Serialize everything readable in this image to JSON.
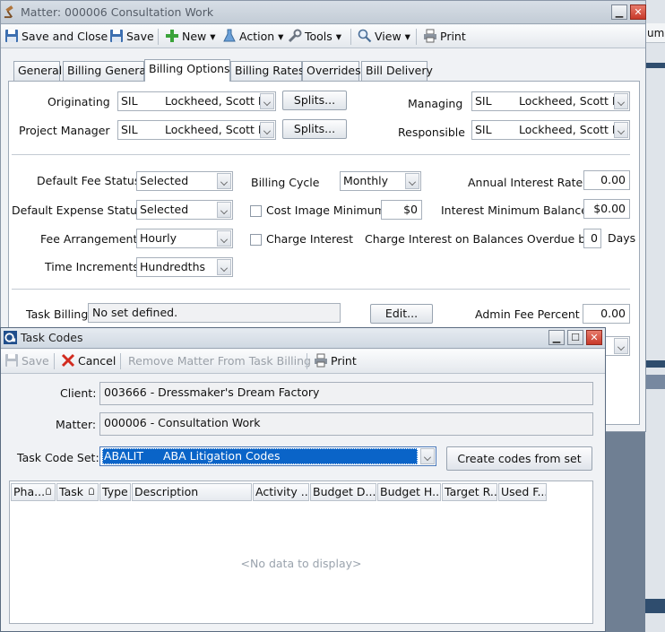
{
  "matter_window": {
    "title": "Matter: 000006 Consultation Work",
    "toolbar": {
      "save_close": "Save and Close",
      "save": "Save",
      "new": "New",
      "action": "Action",
      "tools": "Tools",
      "view": "View",
      "print": "Print"
    },
    "tabs": [
      "General",
      "Billing General",
      "Billing Options",
      "Billing Rates",
      "Overrides",
      "Bill Delivery"
    ],
    "active_tab": "Billing Options",
    "people": {
      "originating_label": "Originating",
      "originating_code": "SIL",
      "originating_name": "Lockheed, Scott I.",
      "project_manager_label": "Project Manager",
      "project_manager_code": "SIL",
      "project_manager_name": "Lockheed, Scott I.",
      "managing_label": "Managing",
      "managing_code": "SIL",
      "managing_name": "Lockheed, Scott I.",
      "responsible_label": "Responsible",
      "responsible_code": "SIL",
      "responsible_name": "Lockheed, Scott I.",
      "splits_label": "Splits..."
    },
    "billing": {
      "default_fee_status_label": "Default Fee Status",
      "default_fee_status": "Selected",
      "default_expense_status_label": "Default Expense Status",
      "default_expense_status": "Selected",
      "fee_arrangement_label": "Fee Arrangement",
      "fee_arrangement": "Hourly",
      "time_increments_label": "Time Increments",
      "time_increments": "Hundredths",
      "billing_cycle_label": "Billing Cycle",
      "billing_cycle": "Monthly",
      "cost_image_minimum_label": "Cost Image Minimum",
      "cost_image_minimum": "$0",
      "charge_interest_label": "Charge Interest",
      "annual_interest_rate_label": "Annual Interest Rate",
      "annual_interest_rate": "0.00",
      "interest_minimum_balance_label": "Interest Minimum Balance",
      "interest_minimum_balance": "$0.00",
      "charge_interest_overdue_label": "Charge Interest on Balances Overdue by",
      "charge_interest_overdue_days": "0",
      "days_label": "Days",
      "task_billing_label": "Task Billing",
      "task_billing_value": "No set defined.",
      "edit_label": "Edit...",
      "admin_fee_percent_label": "Admin Fee Percent",
      "admin_fee_percent": "0.00"
    }
  },
  "background_fragment": "um",
  "task_window": {
    "title": "Task Codes",
    "toolbar": {
      "save": "Save",
      "cancel": "Cancel",
      "remove": "Remove Matter From Task Billing",
      "print": "Print"
    },
    "client_label": "Client:",
    "client_value": "003666 - Dressmaker's Dream Factory",
    "matter_label": "Matter:",
    "matter_value": "000006 - Consultation Work",
    "task_code_set_label": "Task Code Set:",
    "task_code_set_code": "ABALIT",
    "task_code_set_name": "ABA Litigation Codes",
    "create_codes_label": "Create codes from set",
    "columns": [
      "Pha...",
      "Task",
      "Type",
      "Description",
      "Activity ...",
      "Budget D...",
      "Budget H...",
      "Target R...",
      "Used F..."
    ],
    "no_data": "<No data to display>"
  },
  "colors": {
    "accent_selection": "#0a64c8",
    "title_inactive": "#555d68",
    "close_red": "#c8392a"
  }
}
